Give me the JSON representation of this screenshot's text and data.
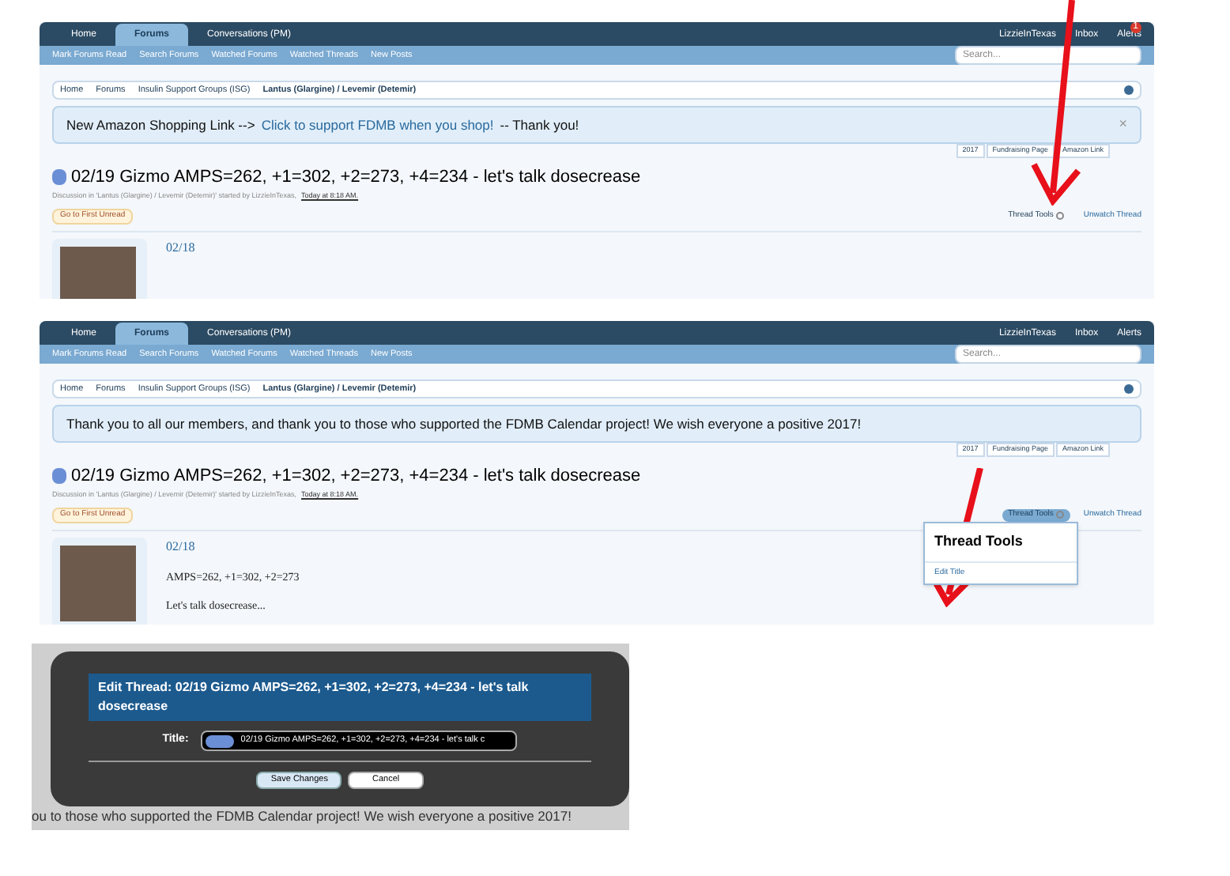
{
  "screenshots": [
    {
      "nav": {
        "tabs": [
          {
            "label": "Home",
            "selected": false
          },
          {
            "label": "Forums",
            "selected": true
          },
          {
            "label": "Conversations (PM)",
            "selected": false
          }
        ],
        "user": "LizzieInTexas",
        "inbox": "Inbox",
        "alerts": "Alerts",
        "alerts_badge": "1"
      },
      "subnav": [
        "Mark Forums Read",
        "Search Forums",
        "Watched Forums",
        "Watched Threads",
        "New Posts"
      ],
      "search": {
        "placeholder": "Search..."
      },
      "breadcrumbs": [
        "Home",
        "Forums",
        "Insulin Support Groups (ISG)",
        "Lantus (Glargine) / Levemir (Detemir)"
      ],
      "notice": {
        "text": "New Amazon Shopping Link -->",
        "link": "Click to support FDMB when you shop!",
        "tail": "-- Thank you!",
        "close": "×"
      },
      "notice_tabs": [
        "2017",
        "Fundraising Page",
        "Amazon Link"
      ],
      "thread": {
        "title": "02/19 Gizmo AMPS=262, +1=302, +2=273, +4=234 - let's talk dosecrease",
        "meta": "Discussion in 'Lantus (Glargine) / Levemir (Detemir)' started by LizzieInTexas,",
        "time": "Today at 8:18 AM."
      },
      "first_unread": "Go to First Unread",
      "thread_tools": {
        "label": "Thread Tools",
        "open": false
      },
      "unwatch": "Unwatch Thread",
      "post": {
        "date": "02/18"
      }
    },
    {
      "nav": {
        "tabs": [
          {
            "label": "Home",
            "selected": false
          },
          {
            "label": "Forums",
            "selected": true
          },
          {
            "label": "Conversations (PM)",
            "selected": false
          }
        ],
        "user": "LizzieInTexas",
        "inbox": "Inbox",
        "alerts": "Alerts"
      },
      "subnav": [
        "Mark Forums Read",
        "Search Forums",
        "Watched Forums",
        "Watched Threads",
        "New Posts"
      ],
      "search": {
        "placeholder": "Search..."
      },
      "breadcrumbs": [
        "Home",
        "Forums",
        "Insulin Support Groups (ISG)",
        "Lantus (Glargine) / Levemir (Detemir)"
      ],
      "notice": {
        "text": "Thank you to all our members, and thank you to those who supported the FDMB Calendar project! We wish everyone a positive 2017!"
      },
      "notice_tabs": [
        "2017",
        "Fundraising Page",
        "Amazon Link"
      ],
      "thread": {
        "title": "02/19 Gizmo AMPS=262, +1=302, +2=273, +4=234 - let's talk dosecrease",
        "meta": "Discussion in 'Lantus (Glargine) / Levemir (Detemir)' started by LizzieInTexas,",
        "time": "Today at 8:18 AM."
      },
      "first_unread": "Go to First Unread",
      "thread_tools": {
        "label": "Thread Tools",
        "open": true,
        "menu_title": "Thread Tools",
        "menu_items": [
          "Edit Title"
        ]
      },
      "unwatch": "Unwatch Thread",
      "post": {
        "date": "02/18",
        "lines": [
          "AMPS=262, +1=302, +2=273",
          "Let's talk dosecrease..."
        ]
      }
    }
  ],
  "dialog": {
    "background_text": "ou to those who supported the FDMB Calendar project! We wish everyone a positive 2017!",
    "title": "Edit Thread: 02/19 Gizmo AMPS=262, +1=302, +2=273, +4=234 - let's talk dosecrease",
    "field_label": "Title:",
    "field_value": "02/19 Gizmo AMPS=262, +1=302, +2=273, +4=234 - let's talk c",
    "buttons": [
      {
        "label": "Save Changes",
        "kind": "primary"
      },
      {
        "label": "Cancel",
        "kind": "secondary"
      }
    ]
  }
}
